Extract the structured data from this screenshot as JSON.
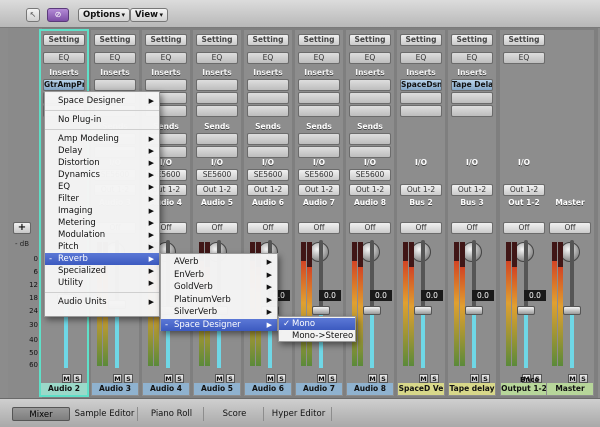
{
  "toolbar": {
    "options_label": "Options",
    "view_label": "View",
    "arrow": "▾"
  },
  "left_rail": {
    "add_label": "+",
    "db_label": "- dB",
    "scale": [
      "0",
      "6",
      "12",
      "18",
      "24",
      "30",
      "40",
      "50",
      "60"
    ]
  },
  "strips": [
    {
      "setting": "Setting",
      "eq": "EQ",
      "inserts": "Inserts",
      "plugin": "GtrAmpPro",
      "sends": "",
      "io": "",
      "input": "",
      "output": "",
      "mode": "",
      "automation": "",
      "bottom": "Audio 2",
      "bottom_color": "#9bd9c9"
    },
    {
      "setting": "Setting",
      "eq": "EQ",
      "inserts": "Inserts",
      "plugin": "",
      "sends": "Sends",
      "io": "I/O",
      "input": "SE5600",
      "output": "Out 1-2",
      "mode": "Audio 3",
      "automation": "Off",
      "value": "",
      "bottom": "Audio 3",
      "bottom_color": "#8fb2cf"
    },
    {
      "setting": "Setting",
      "eq": "EQ",
      "inserts": "Inserts",
      "plugin": "",
      "sends": "Sends",
      "io": "I/O",
      "input": "SE5600",
      "output": "Out 1-2",
      "mode": "Audio 4",
      "automation": "Off",
      "value": "",
      "bottom": "Audio 4",
      "bottom_color": "#8fb2cf"
    },
    {
      "setting": "Setting",
      "eq": "EQ",
      "inserts": "Inserts",
      "plugin": "",
      "sends": "Sends",
      "io": "I/O",
      "input": "SE5600",
      "output": "Out 1-2",
      "mode": "Audio 5",
      "automation": "Off",
      "value": "",
      "bottom": "Audio 5",
      "bottom_color": "#8fb2cf"
    },
    {
      "setting": "Setting",
      "eq": "EQ",
      "inserts": "Inserts",
      "plugin": "",
      "sends": "Sends",
      "io": "I/O",
      "input": "SE5600",
      "output": "Out 1-2",
      "mode": "Audio 6",
      "automation": "Off",
      "value": "0.0",
      "bottom": "Audio 6",
      "bottom_color": "#8fb2cf"
    },
    {
      "setting": "Setting",
      "eq": "EQ",
      "inserts": "Inserts",
      "plugin": "",
      "sends": "Sends",
      "io": "I/O",
      "input": "SE5600",
      "output": "Out 1-2",
      "mode": "Audio 7",
      "automation": "Off",
      "value": "0.0",
      "bottom": "Audio 7",
      "bottom_color": "#8fb2cf"
    },
    {
      "setting": "Setting",
      "eq": "EQ",
      "inserts": "Inserts",
      "plugin": "",
      "sends": "Sends",
      "io": "I/O",
      "input": "SE5600",
      "output": "Out 1-2",
      "mode": "Audio 8",
      "automation": "Off",
      "value": "0.0",
      "bottom": "Audio 8",
      "bottom_color": "#8fb2cf"
    },
    {
      "setting": "Setting",
      "eq": "EQ",
      "inserts": "Inserts",
      "plugin": "SpaceDsn",
      "sends": "",
      "io": "I/O",
      "input": "",
      "output": "Out 1-2",
      "mode": "Bus 2",
      "automation": "Off",
      "value": "0.0",
      "bottom": "SpaceD Ve",
      "bottom_color": "#d8d88a"
    },
    {
      "setting": "Setting",
      "eq": "EQ",
      "inserts": "Inserts",
      "plugin": "Tape Dela",
      "sends": "",
      "io": "I/O",
      "input": "",
      "output": "Out 1-2",
      "mode": "Bus 3",
      "automation": "Off",
      "value": "0.0",
      "bottom": "Tape delay",
      "bottom_color": "#d8d88a"
    },
    {
      "setting": "Setting",
      "eq": "EQ",
      "inserts": "",
      "plugin": "",
      "sends": "",
      "io": "I/O",
      "input": "",
      "output": "Out 1-2",
      "mode": "Out 1-2",
      "automation": "Off",
      "value": "0.0",
      "bottom": "Output 1-2",
      "bottom_color": "#b7d69a",
      "bnce": "Bnce"
    },
    {
      "setting": "",
      "eq": "",
      "inserts": "",
      "plugin": "",
      "sends": "",
      "io": "",
      "input": "",
      "output": "",
      "mode": "Master",
      "automation": "Off",
      "value": "",
      "bottom": "Master",
      "bottom_color": "#b7d69a"
    }
  ],
  "strip_buttons": {
    "m": "M",
    "s": "S",
    "o": "O",
    "i": "I",
    "r": "R"
  },
  "main_menu": {
    "items": [
      {
        "label": "Space Designer",
        "sub": "▶"
      },
      {
        "label": "No Plug-in",
        "sub": ""
      },
      {
        "label": "Amp Modeling",
        "sub": "▶"
      },
      {
        "label": "Delay",
        "sub": "▶"
      },
      {
        "label": "Distortion",
        "sub": "▶"
      },
      {
        "label": "Dynamics",
        "sub": "▶"
      },
      {
        "label": "EQ",
        "sub": "▶"
      },
      {
        "label": "Filter",
        "sub": "▶"
      },
      {
        "label": "Imaging",
        "sub": "▶"
      },
      {
        "label": "Metering",
        "sub": "▶"
      },
      {
        "label": "Modulation",
        "sub": "▶"
      },
      {
        "label": "Pitch",
        "sub": "▶"
      },
      {
        "label": "Reverb",
        "sub": "▶",
        "highlight": true,
        "dash": "-"
      },
      {
        "label": "Specialized",
        "sub": "▶"
      },
      {
        "label": "Utility",
        "sub": "▶"
      },
      {
        "label": "Audio Units",
        "sub": "▶"
      }
    ]
  },
  "reverb_menu": {
    "items": [
      {
        "label": "AVerb",
        "sub": "▶"
      },
      {
        "label": "EnVerb",
        "sub": "▶"
      },
      {
        "label": "GoldVerb",
        "sub": "▶"
      },
      {
        "label": "PlatinumVerb",
        "sub": "▶"
      },
      {
        "label": "SilverVerb",
        "sub": "▶"
      },
      {
        "label": "Space Designer",
        "sub": "▶",
        "highlight": true,
        "dash": "-"
      }
    ]
  },
  "space_menu": {
    "items": [
      {
        "label": "Mono",
        "check": "✓",
        "highlight": true
      },
      {
        "label": "Mono->Stereo",
        "check": ""
      }
    ]
  },
  "tabs": [
    "Mixer",
    "Sample Editor",
    "Piano Roll",
    "Score",
    "Hyper Editor"
  ]
}
